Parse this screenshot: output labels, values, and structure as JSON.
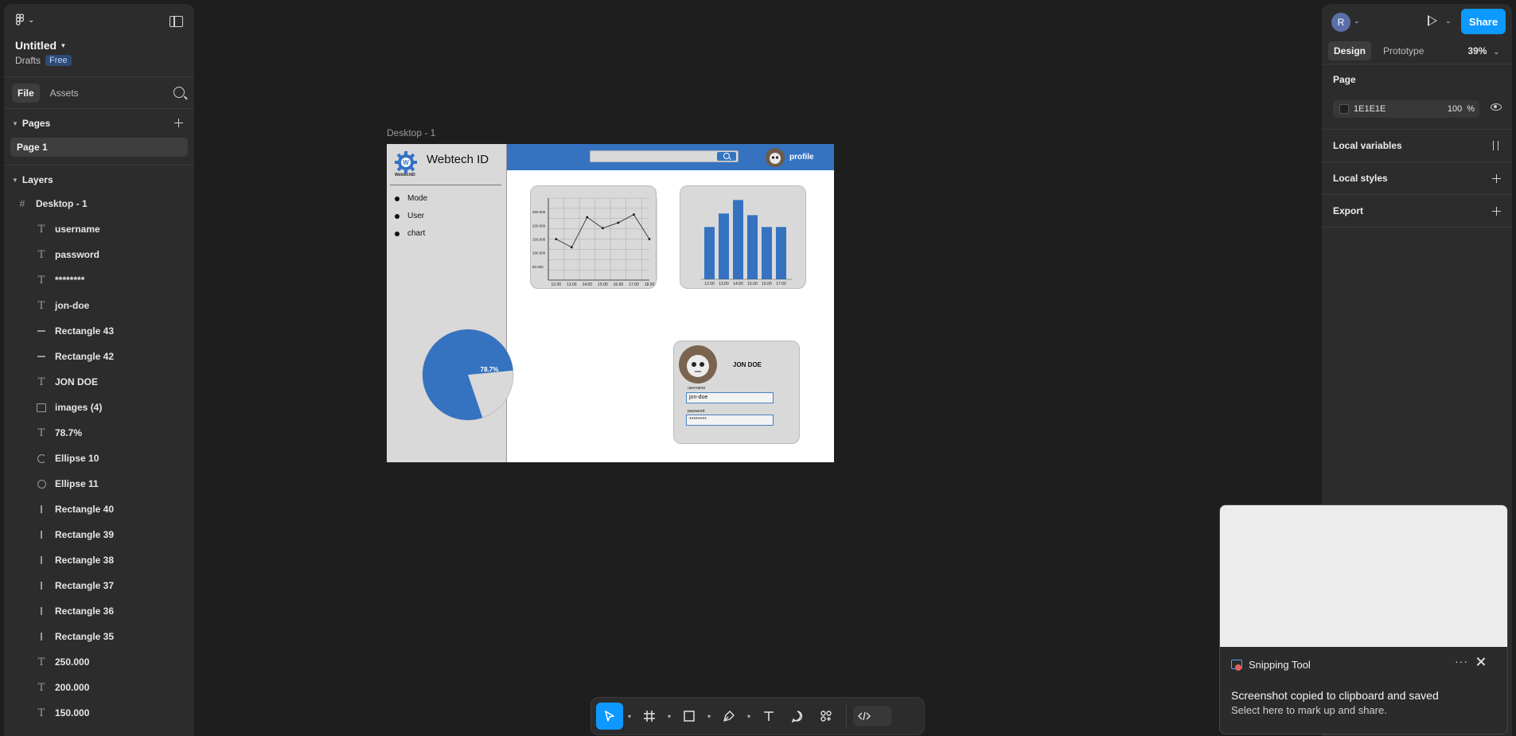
{
  "file": {
    "title": "Untitled",
    "location": "Drafts",
    "plan_badge": "Free"
  },
  "left_tabs": {
    "file": "File",
    "assets": "Assets"
  },
  "pages": {
    "header": "Pages",
    "items": [
      "Page 1"
    ]
  },
  "layers": {
    "header": "Layers",
    "root": "Desktop - 1",
    "items": [
      {
        "name": "username",
        "icon": "text-icon"
      },
      {
        "name": "password",
        "icon": "text-icon"
      },
      {
        "name": "********",
        "icon": "text-icon"
      },
      {
        "name": "jon-doe",
        "icon": "text-icon"
      },
      {
        "name": "Rectangle 43",
        "icon": "line-icon"
      },
      {
        "name": "Rectangle 42",
        "icon": "line-icon"
      },
      {
        "name": "JON DOE",
        "icon": "text-icon"
      },
      {
        "name": "images (4)",
        "icon": "image-icon"
      },
      {
        "name": "78.7%",
        "icon": "text-icon"
      },
      {
        "name": "Ellipse 10",
        "icon": "pie-icon"
      },
      {
        "name": "Ellipse 11",
        "icon": "ellipse-icon"
      },
      {
        "name": "Rectangle 40",
        "icon": "vbar-icon"
      },
      {
        "name": "Rectangle 39",
        "icon": "vbar-icon"
      },
      {
        "name": "Rectangle 38",
        "icon": "vbar-icon"
      },
      {
        "name": "Rectangle 37",
        "icon": "vbar-icon"
      },
      {
        "name": "Rectangle 36",
        "icon": "vbar-icon"
      },
      {
        "name": "Rectangle 35",
        "icon": "vbar-icon"
      },
      {
        "name": "250.000",
        "icon": "text-icon"
      },
      {
        "name": "200.000",
        "icon": "text-icon"
      },
      {
        "name": "150.000",
        "icon": "text-icon"
      }
    ]
  },
  "canvas": {
    "frame_label": "Desktop - 1",
    "design": {
      "brand": "Webtech ID",
      "brand_small": "WebtechID",
      "nav": [
        "Mode",
        "User",
        "chart"
      ],
      "profile_label": "profile",
      "line_chart": {
        "y_ticks": [
          "250.000",
          "200.000",
          "150.000",
          "100.000",
          "50.000"
        ],
        "x_ticks": [
          "12.00",
          "13.00",
          "14.00",
          "15.00",
          "16.00",
          "17.00",
          "18.00"
        ],
        "values": [
          150000,
          120000,
          230000,
          190000,
          210000,
          240000,
          150000
        ]
      },
      "bar_chart": {
        "x_ticks": [
          "12.00",
          "13.00",
          "14.00",
          "15.00",
          "16.00",
          "17.00"
        ],
        "values": [
          0.62,
          0.78,
          0.94,
          0.76,
          0.62,
          0.62
        ]
      },
      "pie_chart": {
        "value": 78.7,
        "label": "78.7%"
      },
      "user_card": {
        "name": "JON DOE",
        "username_label": "username",
        "username_value": "jon-doe",
        "password_label": "password",
        "password_value": "********"
      }
    }
  },
  "right_panel": {
    "avatar_initial": "R",
    "share": "Share",
    "tabs": {
      "design": "Design",
      "prototype": "Prototype"
    },
    "zoom": "39%",
    "page": {
      "title": "Page",
      "color": "1E1E1E",
      "opacity": "100",
      "opacity_unit": "%"
    },
    "local_variables": "Local variables",
    "local_styles": "Local styles",
    "export": "Export"
  },
  "notification": {
    "app": "Snipping Tool",
    "title": "Screenshot copied to clipboard and saved",
    "subtitle": "Select here to mark up and share."
  },
  "colors": {
    "accent": "#0d99ff",
    "design_blue": "#3573c1",
    "canvas_bg": "#1e1e1e",
    "panel_bg": "#2c2c2c"
  }
}
